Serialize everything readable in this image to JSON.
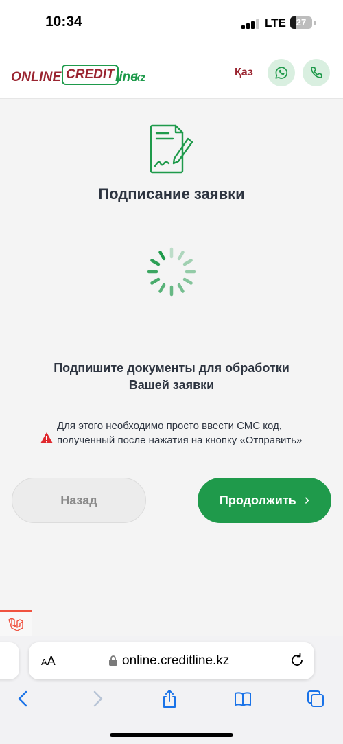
{
  "status_bar": {
    "time": "10:34",
    "network": "LTE",
    "battery": "27",
    "battery_level": 0.27
  },
  "header": {
    "logo": {
      "part1": "ONLINE.",
      "part2": "CREDIT",
      "part3": "line",
      "part4": ".kz"
    },
    "language": "Қаз",
    "whatsapp_icon": "whatsapp-icon",
    "phone_icon": "phone-icon"
  },
  "main": {
    "icon": "document-sign-icon",
    "title": "Подписание заявки",
    "subtitle": "Подпишите документы для обработки Вашей заявки",
    "warning": "Для этого необходимо просто ввести СМС код, полученный после нажатия на кнопку «Отправить»",
    "back_label": "Назад",
    "next_label": "Продолжить",
    "next_chevron": "›"
  },
  "browser": {
    "aa_label_large": "A",
    "aa_label_small": "A",
    "url": "online.creditline.kz"
  },
  "colors": {
    "brand_green": "#1f9a4b",
    "brand_red": "#9a2430",
    "warning_red": "#e0282e"
  }
}
